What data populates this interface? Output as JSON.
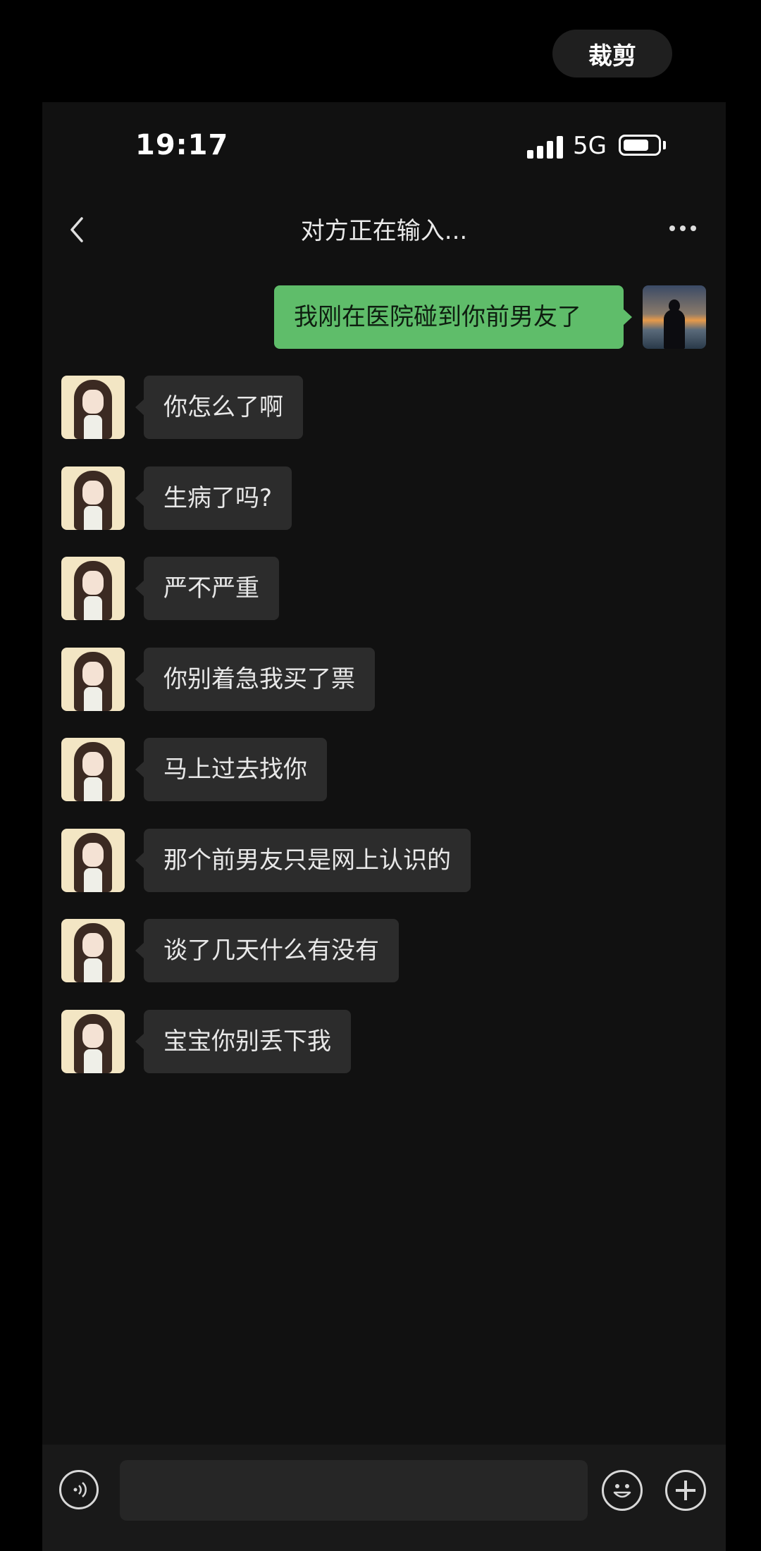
{
  "overlay": {
    "crop_label": "裁剪"
  },
  "status_bar": {
    "time": "19:17",
    "network": "5G"
  },
  "chat": {
    "title": "对方正在输入...",
    "outgoing": [
      {
        "text": "我刚在医院碰到你前男友了"
      }
    ],
    "incoming": [
      {
        "text": "你怎么了啊"
      },
      {
        "text": "生病了吗?"
      },
      {
        "text": "严不严重"
      },
      {
        "text": "你别着急我买了票"
      },
      {
        "text": "马上过去找你"
      },
      {
        "text": "那个前男友只是网上认识的"
      },
      {
        "text": "谈了几天什么有没有"
      },
      {
        "text": "宝宝你别丢下我"
      }
    ]
  },
  "input_bar": {
    "message_value": "",
    "icons": [
      "voice-icon",
      "emoji-icon",
      "plus-icon"
    ]
  },
  "colors": {
    "outgoing_bubble": "#5fbd6a",
    "incoming_bubble": "#2c2c2c",
    "background": "#111111"
  }
}
